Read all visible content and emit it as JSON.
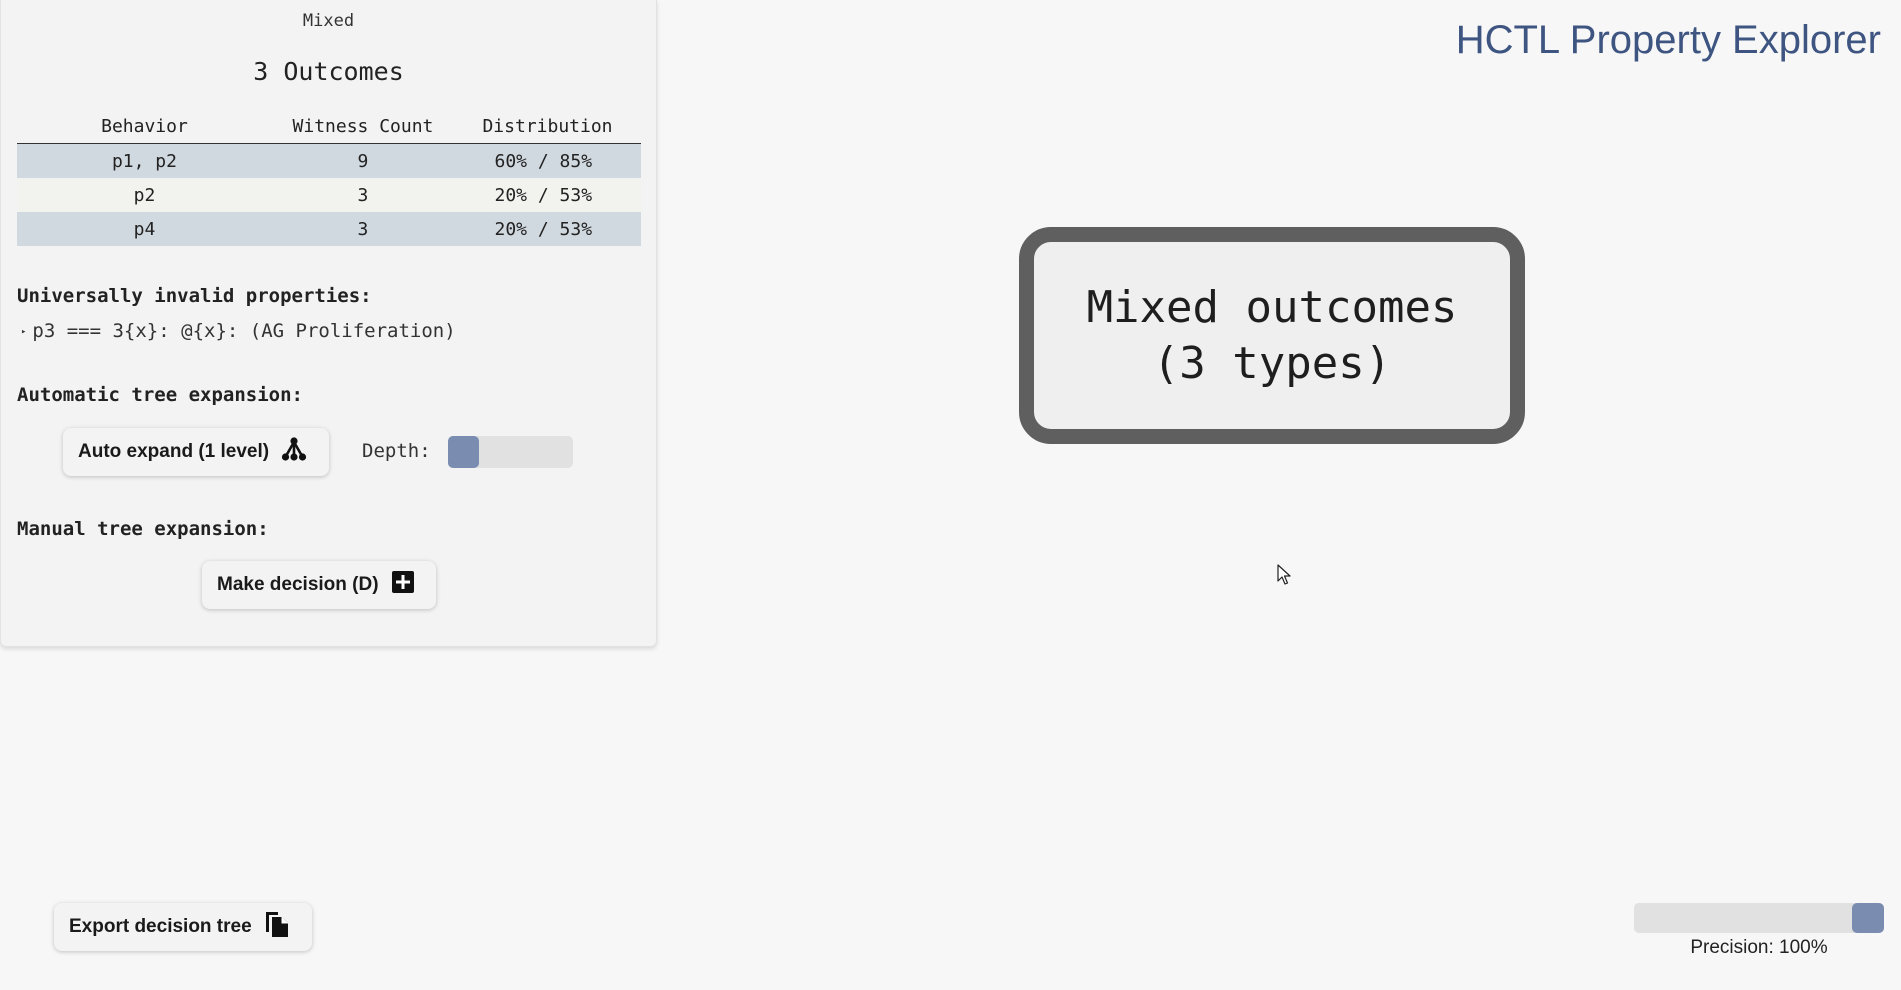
{
  "app_title": "HCTL Property Explorer",
  "side_panel": {
    "node_type": "Mixed",
    "title": "3 Outcomes",
    "table": {
      "headers": [
        "Behavior",
        "Witness Count",
        "Distribution"
      ],
      "rows": [
        {
          "behavior": "p1, p2",
          "witness_count": "9",
          "distribution": "60% / 85%"
        },
        {
          "behavior": "p2",
          "witness_count": "3",
          "distribution": "20% / 53%"
        },
        {
          "behavior": "p4",
          "witness_count": "3",
          "distribution": "20% / 53%"
        }
      ]
    },
    "invalid_label": "Universally invalid properties:",
    "invalid_properties": [
      "p3 === 3{x}: @{x}: (AG Proliferation)"
    ],
    "auto_label": "Automatic tree expansion:",
    "auto_button": "Auto expand (1 level)",
    "depth_label": "Depth:",
    "depth_value": 1,
    "manual_label": "Manual tree expansion:",
    "decision_button": "Make decision (D)"
  },
  "node": {
    "line1": "Mixed outcomes",
    "line2": "(3 types)"
  },
  "export_button": "Export decision tree",
  "precision": {
    "label": "Precision: 100%",
    "value": 1.0
  },
  "colors": {
    "accent": "#7a8db1",
    "title": "#3e5582",
    "row_shade": "#d1d9e0",
    "node_border": "#5f5f5f"
  },
  "icons": {
    "auto_expand": "tree-structure-icon",
    "decision": "plus-box-icon",
    "export": "copy-document-icon"
  }
}
